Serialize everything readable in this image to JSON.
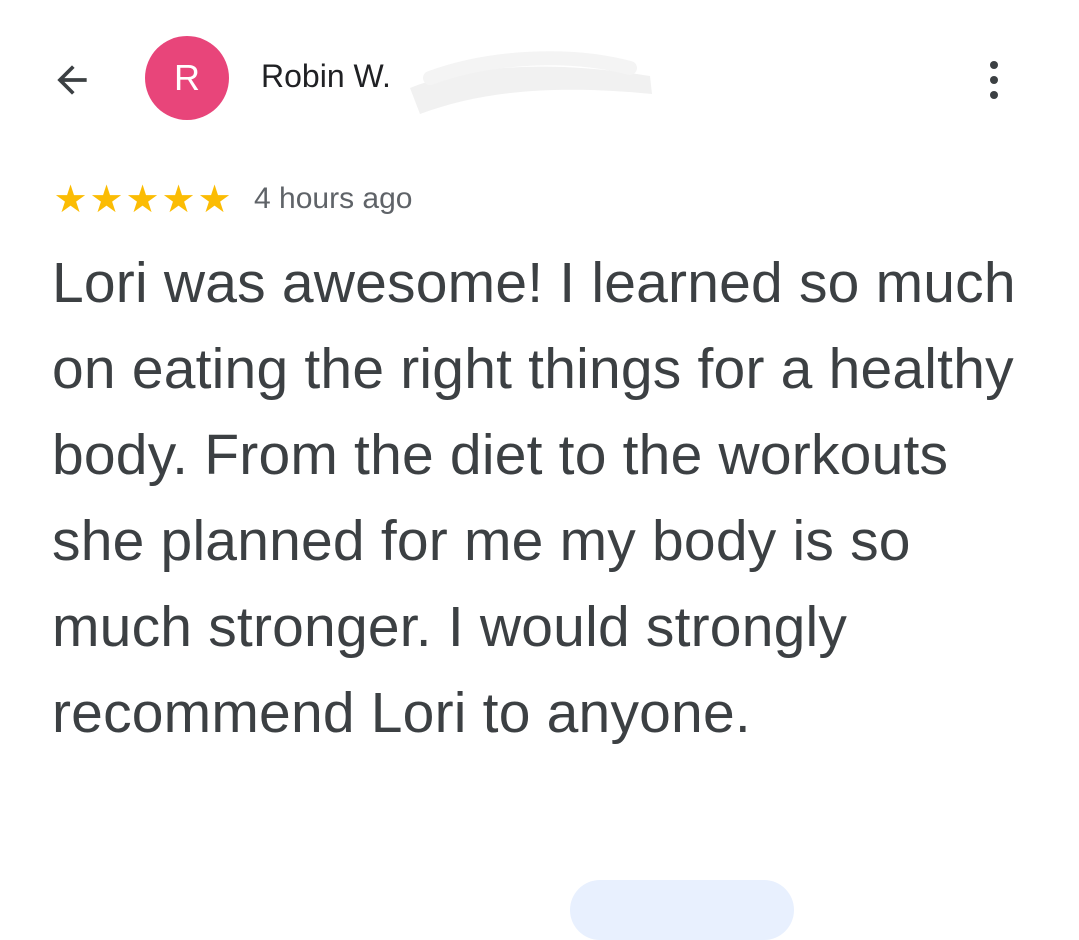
{
  "header": {
    "back_icon": "arrow-left-icon",
    "avatar_letter": "R",
    "avatar_color": "#e8457a",
    "reviewer_name": "Robin W.",
    "more_icon": "more-vert-icon"
  },
  "review": {
    "rating": 5,
    "stars": [
      "★",
      "★",
      "★",
      "★",
      "★"
    ],
    "star_color": "#fbbc04",
    "time_ago": "4 hours ago",
    "text": "Lori was awesome! I learned so much on eating the right things for a healthy body. From the diet to the workouts she planned for me my body is so much stronger. I would strongly recommend Lori to anyone."
  }
}
